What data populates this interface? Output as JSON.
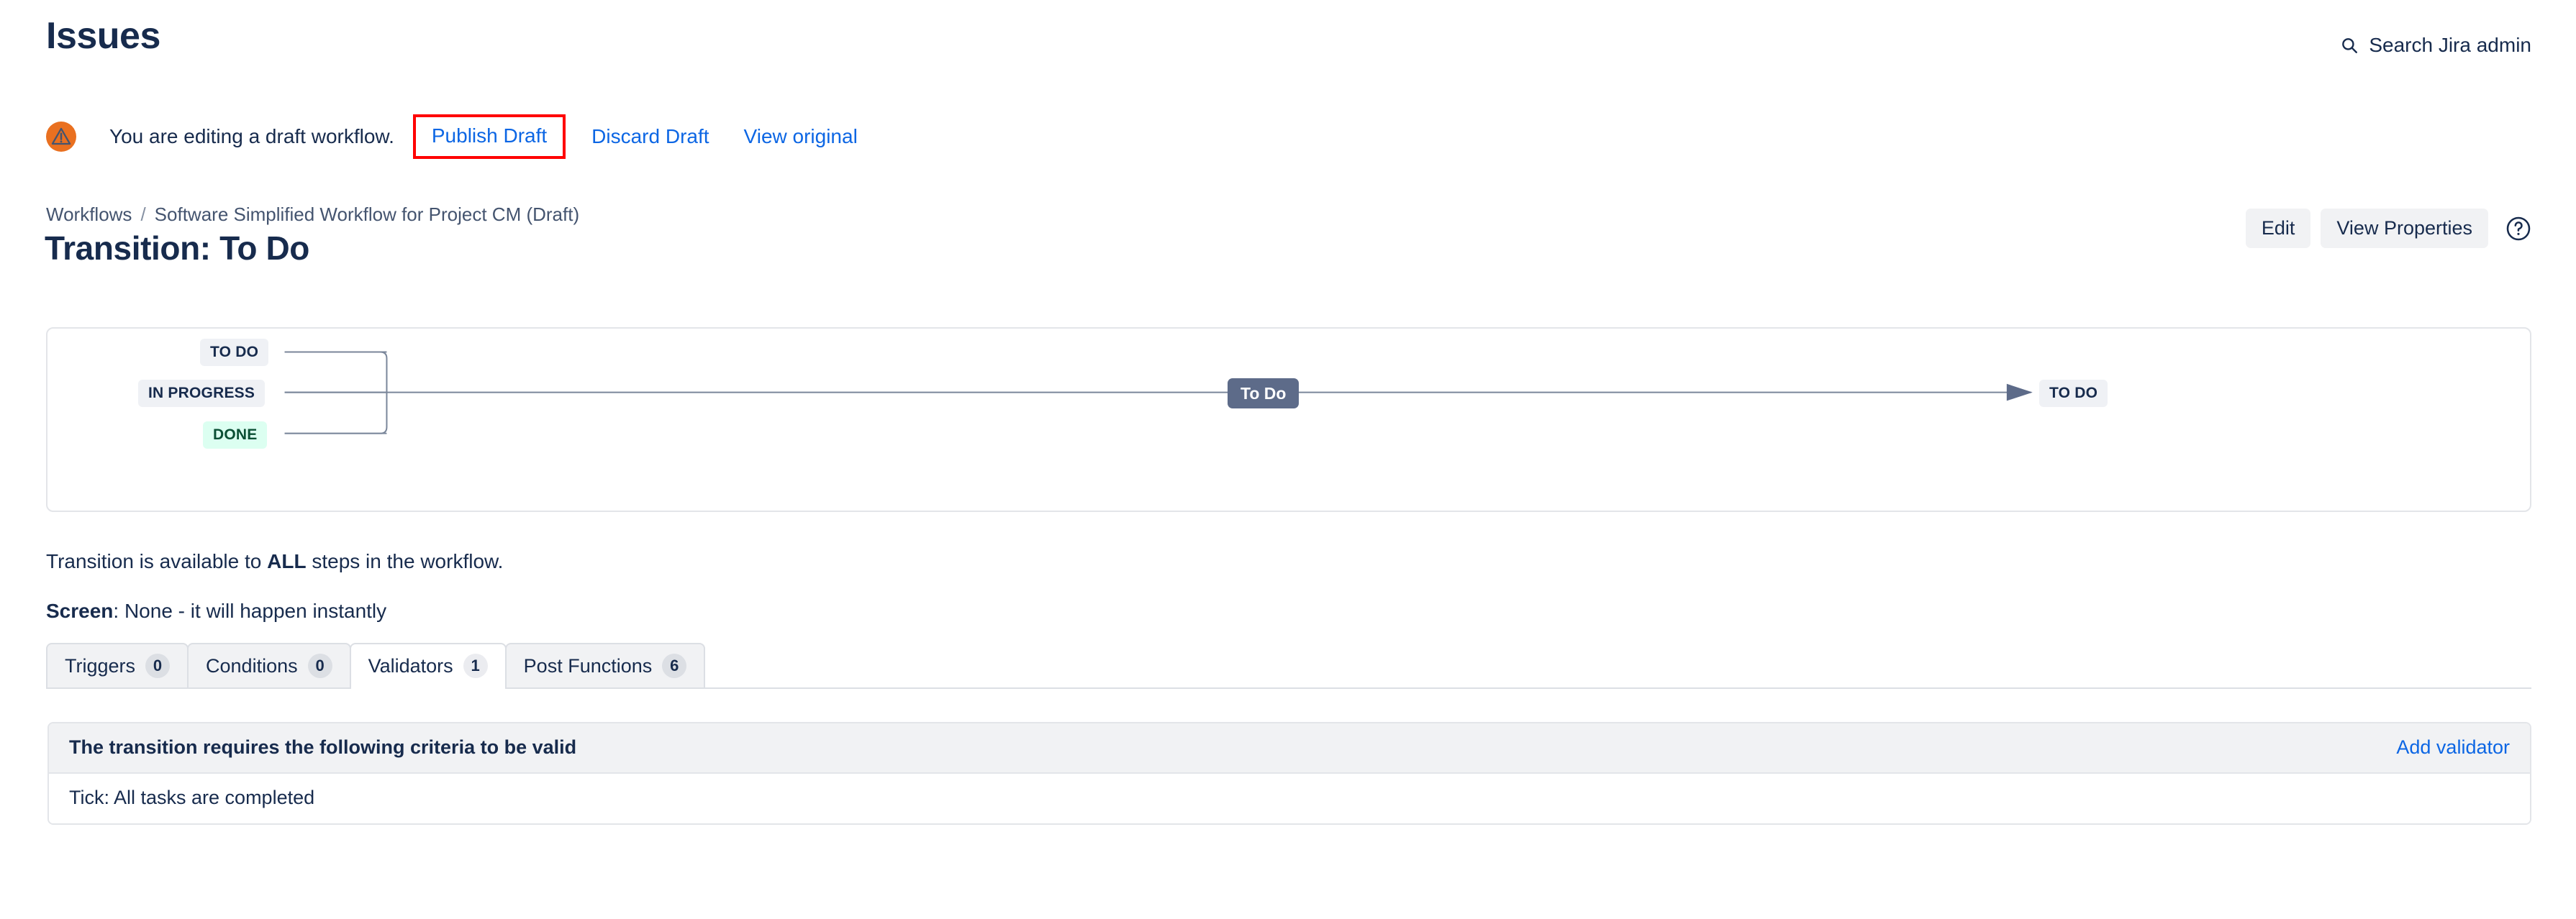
{
  "header": {
    "page_title": "Issues",
    "search": {
      "label": "Search Jira admin",
      "icon": "search-icon"
    }
  },
  "draft_banner": {
    "icon": "warning-icon",
    "message": "You are editing a draft workflow.",
    "publish_label": "Publish Draft",
    "discard_label": "Discard Draft",
    "view_original_label": "View original",
    "highlight_color": "#FF0000"
  },
  "breadcrumb": {
    "root": "Workflows",
    "separator": "/",
    "current": "Software Simplified Workflow for Project CM (Draft)"
  },
  "title": {
    "text": "Transition: To Do",
    "edit_label": "Edit",
    "view_properties_label": "View Properties",
    "help_icon": "help-circle-icon"
  },
  "diagram": {
    "source_statuses": [
      {
        "label": "TO DO",
        "color": "#EFF1F5"
      },
      {
        "label": "IN PROGRESS",
        "color": "#EFF1F5"
      },
      {
        "label": "DONE",
        "color": "#DCFFF1"
      }
    ],
    "transition_label": "To Do",
    "target_status": {
      "label": "TO DO",
      "color": "#EFF1F5"
    },
    "line_color": "#7A869A"
  },
  "info": {
    "availability_prefix": "Transition is available to ",
    "availability_strong": "ALL",
    "availability_suffix": " steps in the workflow.",
    "screen_label": "Screen",
    "screen_value": ": None - it will happen instantly"
  },
  "tabs": [
    {
      "label": "Triggers",
      "count": "0",
      "active": false
    },
    {
      "label": "Conditions",
      "count": "0",
      "active": false
    },
    {
      "label": "Validators",
      "count": "1",
      "active": true
    },
    {
      "label": "Post Functions",
      "count": "6",
      "active": false
    }
  ],
  "validators_panel": {
    "heading": "The transition requires the following criteria to be valid",
    "add_label": "Add validator",
    "rows": [
      {
        "text": "Tick: All tasks are completed"
      }
    ]
  }
}
